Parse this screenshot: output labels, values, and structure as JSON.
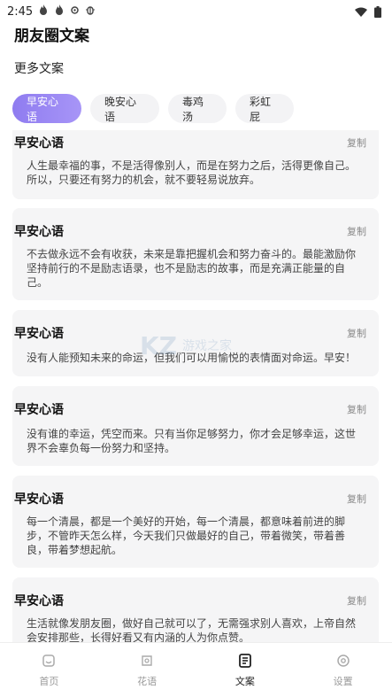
{
  "status_bar": {
    "time": "2:45",
    "icons": [
      "flame-icon",
      "flame-icon",
      "sync-icon",
      "bug-icon"
    ],
    "right_icons": [
      "wifi-icon",
      "battery-icon"
    ]
  },
  "app": {
    "title": "朋友圈文案"
  },
  "section": {
    "title": "更多文案"
  },
  "tabs": [
    {
      "label": "早安心语",
      "active": true
    },
    {
      "label": "晚安心语",
      "active": false
    },
    {
      "label": "毒鸡汤",
      "active": false
    },
    {
      "label": "彩虹屁",
      "active": false
    }
  ],
  "copy_label": "复制",
  "cards": [
    {
      "title": "早安心语",
      "text": "人生最幸福的事，不是活得像别人，而是在努力之后，活得更像自己。所以，只要还有努力的机会，就不要轻易说放弃。"
    },
    {
      "title": "早安心语",
      "text": "不去做永远不会有收获，未来是靠把握机会和努力奋斗的。最能激励你坚持前行的不是励志语录，也不是励志的故事，而是充满正能量的自己。"
    },
    {
      "title": "早安心语",
      "text": "没有人能预知未来的命运，但我们可以用愉悦的表情面对命运。早安！"
    },
    {
      "title": "早安心语",
      "text": "没有谁的幸运，凭空而来。只有当你足够努力，你才会足够幸运，这世界不会辜负每一份努力和坚持。"
    },
    {
      "title": "早安心语",
      "text": "每一个清晨，都是一个美好的开始，每一个清晨，都意味着前进的脚步，不管昨天怎么样，今天我们只做最好的自己，带着微笑，带着善良，带着梦想起航。"
    },
    {
      "title": "早安心语",
      "text": "生活就像发朋友圈，做好自己就可以了，无需强求别人喜欢，上帝自然会安排那些，长得好看又有内涵的人为你点赞。"
    }
  ],
  "watermark": {
    "brand": "KZ",
    "text": "游戏之家"
  },
  "nav": [
    {
      "label": "首页",
      "icon": "home-icon",
      "active": false
    },
    {
      "label": "花语",
      "icon": "flower-icon",
      "active": false
    },
    {
      "label": "文案",
      "icon": "document-icon",
      "active": true
    },
    {
      "label": "设置",
      "icon": "gear-icon",
      "active": false
    }
  ],
  "colors": {
    "accent_start": "#8f7cf0",
    "accent_end": "#a795f7",
    "card_bg": "#f5f5f6"
  }
}
